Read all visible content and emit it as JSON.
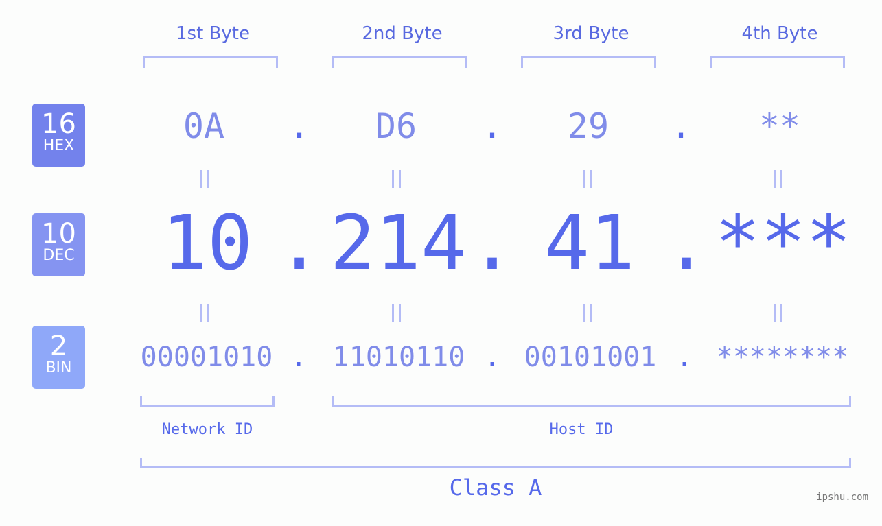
{
  "bytes": [
    {
      "label": "1st Byte",
      "hex": "0A",
      "dec": "10",
      "bin": "00001010"
    },
    {
      "label": "2nd Byte",
      "hex": "D6",
      "dec": "214",
      "bin": "11010110"
    },
    {
      "label": "3rd Byte",
      "hex": "29",
      "dec": "41",
      "bin": "00101001"
    },
    {
      "label": "4th Byte",
      "hex": "**",
      "dec": "***",
      "bin": "********"
    }
  ],
  "separator": ".",
  "equals": "=",
  "badges": [
    {
      "num": "16",
      "label": "HEX",
      "color": "#7382ec"
    },
    {
      "num": "10",
      "label": "DEC",
      "color": "#8594f1"
    },
    {
      "num": "2",
      "label": "BIN",
      "color": "#8fa8f9"
    }
  ],
  "network_id_label": "Network ID",
  "host_id_label": "Host ID",
  "class_label": "Class A",
  "watermark": "ipshu.com"
}
